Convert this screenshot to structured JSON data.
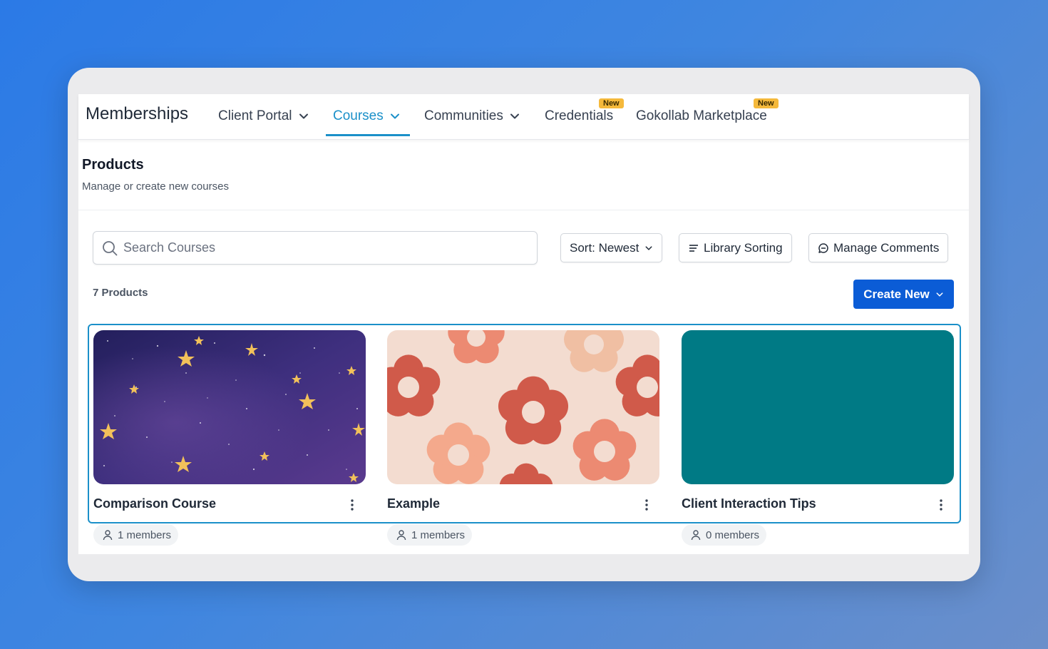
{
  "nav": {
    "brand": "Memberships",
    "items": [
      {
        "label": "Client Portal",
        "dropdown": true,
        "active": false
      },
      {
        "label": "Courses",
        "dropdown": true,
        "active": true
      },
      {
        "label": "Communities",
        "dropdown": true,
        "active": false
      },
      {
        "label": "Credentials",
        "dropdown": false,
        "badge": "New"
      },
      {
        "label": "Gokollab Marketplace",
        "dropdown": false,
        "badge": "New"
      }
    ]
  },
  "header": {
    "title": "Products",
    "subtitle": "Manage or create new courses"
  },
  "toolbar": {
    "search_placeholder": "Search Courses",
    "sort_label": "Sort: Newest",
    "library_sorting_label": "Library Sorting",
    "manage_comments_label": "Manage Comments",
    "product_count": "7 Products",
    "create_label": "Create New"
  },
  "courses": [
    {
      "title": "Comparison Course",
      "members": "1 members",
      "thumbnail": "night-sky-stars"
    },
    {
      "title": "Example",
      "members": "1 members",
      "thumbnail": "flower-pattern"
    },
    {
      "title": "Client Interaction Tips",
      "members": "0 members",
      "thumbnail": "solid-teal"
    }
  ],
  "colors": {
    "accent": "#1b90c9",
    "primary_button": "#0b5cd6",
    "badge": "#f5b93b",
    "teal_thumbnail": "#007a85"
  }
}
